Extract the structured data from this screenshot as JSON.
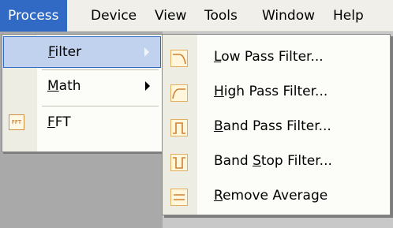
{
  "menubar": {
    "items": [
      {
        "label": "Process",
        "mnemonic": "",
        "active": true
      },
      {
        "label": "Device"
      },
      {
        "label": "View"
      },
      {
        "label": "Tools"
      },
      {
        "label": "Window"
      },
      {
        "label": "Help"
      }
    ]
  },
  "process_menu": {
    "items": [
      {
        "label_pre": "",
        "label_mn": "F",
        "label_post": "ilter",
        "has_submenu": true,
        "highlighted": true
      },
      {
        "label_pre": "",
        "label_mn": "M",
        "label_post": "ath",
        "has_submenu": true
      },
      {
        "label_pre": "",
        "label_mn": "F",
        "label_post": "FT",
        "icon": "fft-icon",
        "icon_text": "FFT"
      }
    ]
  },
  "filter_submenu": {
    "items": [
      {
        "label_pre": "",
        "label_mn": "L",
        "label_post": "ow Pass Filter...",
        "icon": "low-pass-filter-icon"
      },
      {
        "label_pre": "",
        "label_mn": "H",
        "label_post": "igh Pass Filter...",
        "icon": "high-pass-filter-icon"
      },
      {
        "label_pre": "",
        "label_mn": "B",
        "label_post": "and Pass Filter...",
        "icon": "band-pass-filter-icon"
      },
      {
        "label_pre": "Band ",
        "label_mn": "S",
        "label_post": "top Filter...",
        "icon": "band-stop-filter-icon"
      },
      {
        "label_pre": "",
        "label_mn": "R",
        "label_post": "emove Average",
        "icon": "remove-average-icon"
      }
    ]
  },
  "colors": {
    "highlight": "#316ac5",
    "hover_fill": "#c1d2ee",
    "menubar_bg": "#f0efe9",
    "icon_orange": "#d08030",
    "icon_blue": "#4a86c8"
  }
}
